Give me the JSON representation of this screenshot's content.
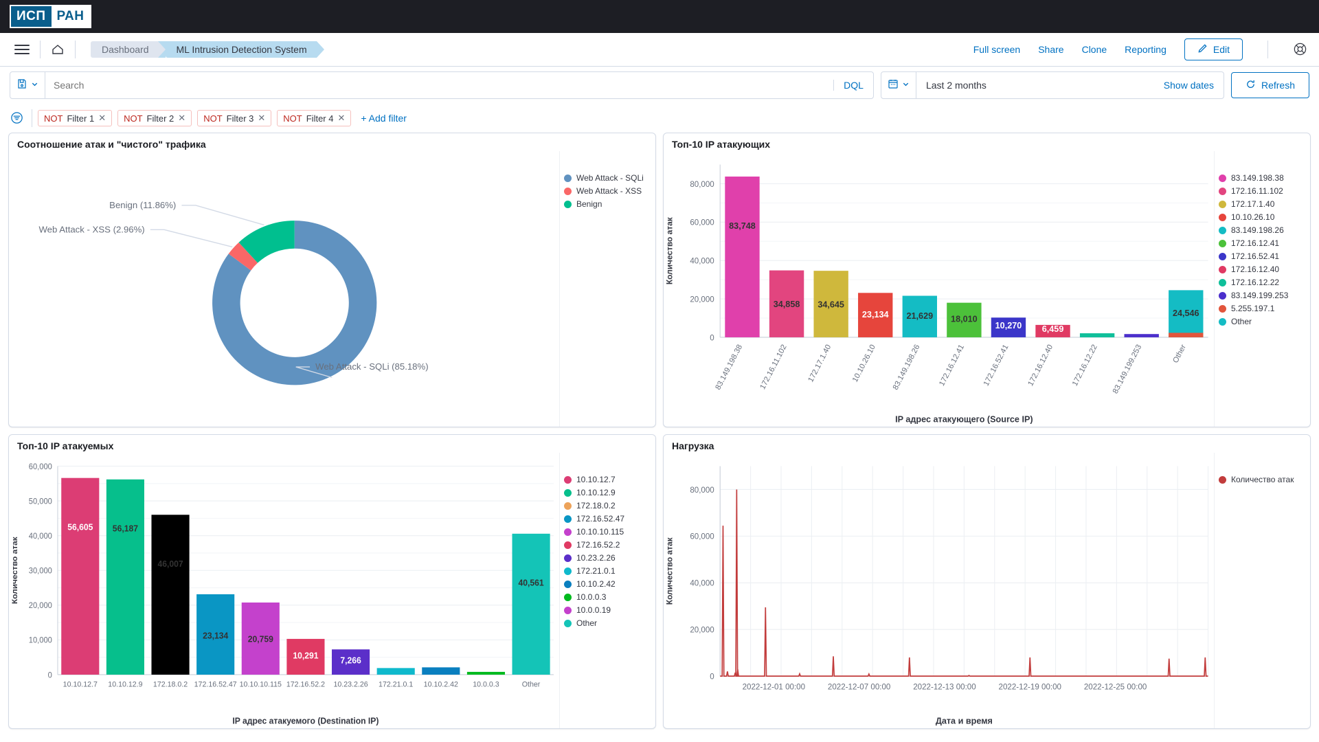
{
  "brand": {
    "logo_left": "ИСП",
    "logo_right": "РАН"
  },
  "header": {
    "menu_icon": "hamburger-icon",
    "home_icon": "home-icon",
    "breadcrumbs": [
      {
        "label": "Dashboard"
      },
      {
        "label": "ML Intrusion Detection System"
      }
    ],
    "links": [
      {
        "label": "Full screen"
      },
      {
        "label": "Share"
      },
      {
        "label": "Clone"
      },
      {
        "label": "Reporting"
      }
    ],
    "edit_label": "Edit",
    "edit_icon": "pencil-icon",
    "help_icon": "help-lifebuoy-icon"
  },
  "query": {
    "saved_query_icon": "saved-query-icon",
    "placeholder": "Search",
    "value": "",
    "language": "DQL",
    "calendar_icon": "calendar-icon",
    "date_range": "Last 2 months",
    "show_dates": "Show dates",
    "refresh_label": "Refresh",
    "refresh_icon": "refresh-icon"
  },
  "filters": {
    "global_icon": "filter-settings-icon",
    "items": [
      {
        "negate": "NOT",
        "label": "Filter 1",
        "remove": "✕"
      },
      {
        "negate": "NOT",
        "label": "Filter 2",
        "remove": "✕"
      },
      {
        "negate": "NOT",
        "label": "Filter 3",
        "remove": "✕"
      },
      {
        "negate": "NOT",
        "label": "Filter 4",
        "remove": "✕"
      }
    ],
    "add_label": "+ Add filter"
  },
  "panels": {
    "donut": {
      "title": "Соотношение атак и \"чистого\" трафика"
    },
    "source": {
      "title": "Топ-10 IP атакующих"
    },
    "dest": {
      "title": "Топ-10 IP атакуемых"
    },
    "load": {
      "title": "Нагрузка"
    }
  },
  "chart_data": [
    {
      "id": "donut",
      "type": "pie",
      "title": "Соотношение атак и \"чистого\" трафика",
      "donut": true,
      "legend_position": "right",
      "labels": [
        "Web Attack - SQLi",
        "Web Attack - XSS",
        "Benign"
      ],
      "values": [
        85.18,
        2.96,
        11.86
      ],
      "unit": "%",
      "colors": [
        "#6092c0",
        "#fa6767",
        "#00bf8f"
      ],
      "callouts": [
        {
          "text": "Benign (11.86%)"
        },
        {
          "text": "Web Attack - XSS (2.96%)"
        },
        {
          "text": "Web Attack - SQLi (85.18%)"
        }
      ],
      "legend": [
        {
          "label": "Web Attack - SQLi",
          "color": "#6092c0"
        },
        {
          "label": "Web Attack - XSS",
          "color": "#fa6767"
        },
        {
          "label": "Benign",
          "color": "#00bf8f"
        }
      ]
    },
    {
      "id": "source_ip",
      "type": "bar",
      "title": "Топ-10 IP атакующих",
      "xlabel": "IP адрес атакующего (Source IP)",
      "ylabel": "Количество атак",
      "ylim": [
        0,
        90000
      ],
      "yticks": [
        0,
        20000,
        40000,
        60000,
        80000
      ],
      "ytick_labels": [
        "0",
        "20,000",
        "40,000",
        "60,000",
        "80,000"
      ],
      "grid": true,
      "legend_position": "right",
      "categories": [
        "83.149.198.38",
        "172.16.11.102",
        "172.17.1.40",
        "10.10.26.10",
        "83.149.198.26",
        "172.16.12.41",
        "172.16.52.41",
        "172.16.12.40",
        "172.16.12.22",
        "83.149.199.253",
        "Other"
      ],
      "values": [
        83748,
        34858,
        34645,
        23134,
        21629,
        18010,
        10270,
        6459,
        2100,
        1700,
        24546
      ],
      "value_labels": [
        "83,748",
        "34,858",
        "34,645",
        "23,134",
        "21,629",
        "18,010",
        "10,270",
        "6,459",
        "",
        "",
        "24,546"
      ],
      "colors": [
        "#e040ab",
        "#e2457f",
        "#cfb83c",
        "#e6453c",
        "#14bcc4",
        "#4cc13a",
        "#3b36c9",
        "#e03a63",
        "#0fbf9a",
        "#4b2fcc",
        "#14bcc4"
      ],
      "legend": [
        {
          "label": "83.149.198.38",
          "color": "#e040ab"
        },
        {
          "label": "172.16.11.102",
          "color": "#e2457f"
        },
        {
          "label": "172.17.1.40",
          "color": "#cfb83c"
        },
        {
          "label": "10.10.26.10",
          "color": "#e6453c"
        },
        {
          "label": "83.149.198.26",
          "color": "#14bcc4"
        },
        {
          "label": "172.16.12.41",
          "color": "#4cc13a"
        },
        {
          "label": "172.16.52.41",
          "color": "#3b36c9"
        },
        {
          "label": "172.16.12.40",
          "color": "#e03a63"
        },
        {
          "label": "172.16.12.22",
          "color": "#0fbf9a"
        },
        {
          "label": "83.149.199.253",
          "color": "#4b2fcc"
        },
        {
          "label": "5.255.197.1",
          "color": "#e2553c"
        },
        {
          "label": "Other",
          "color": "#14bcc4"
        }
      ]
    },
    {
      "id": "dest_ip",
      "type": "bar",
      "title": "Топ-10 IP атакуемых",
      "xlabel": "IP адрес атакуемого (Destination IP)",
      "ylabel": "Количество атак",
      "ylim": [
        0,
        60000
      ],
      "yticks": [
        0,
        10000,
        20000,
        30000,
        40000,
        50000,
        60000
      ],
      "ytick_labels": [
        "0",
        "10,000",
        "20,000",
        "30,000",
        "40,000",
        "50,000",
        "60,000"
      ],
      "grid": true,
      "legend_position": "right",
      "categories": [
        "10.10.12.7",
        "10.10.12.9",
        "172.18.0.2",
        "172.16.52.47",
        "10.10.10.115",
        "172.16.52.2",
        "10.23.2.26",
        "172.21.0.1",
        "10.10.2.42",
        "10.0.0.3",
        "Other"
      ],
      "values": [
        56605,
        56187,
        46007,
        23134,
        20759,
        10291,
        7266,
        1900,
        2100,
        800,
        40561
      ],
      "value_labels": [
        "56,605",
        "56,187",
        "46,007",
        "23,134",
        "20,759",
        "10,291",
        "7,266",
        "",
        "",
        "",
        "40,561"
      ],
      "colors": [
        "#dc3d74",
        "#06bf8c",
        "#edа35a",
        "#0a96c4",
        "#c441cc",
        "#e03a63",
        "#5b2fc9",
        "#0fb9cc",
        "#0a7fbf",
        "#00ba1e",
        "#14c4b7"
      ],
      "legend": [
        {
          "label": "10.10.12.7",
          "color": "#dc3d74"
        },
        {
          "label": "10.10.12.9",
          "color": "#06bf8c"
        },
        {
          "label": "172.18.0.2",
          "color": "#eda35a"
        },
        {
          "label": "172.16.52.47",
          "color": "#0a96c4"
        },
        {
          "label": "10.10.10.115",
          "color": "#c441cc"
        },
        {
          "label": "172.16.52.2",
          "color": "#e03a63"
        },
        {
          "label": "10.23.2.26",
          "color": "#5b2fc9"
        },
        {
          "label": "172.21.0.1",
          "color": "#0fb9cc"
        },
        {
          "label": "10.10.2.42",
          "color": "#0a7fbf"
        },
        {
          "label": "10.0.0.3",
          "color": "#00ba1e"
        },
        {
          "label": "10.0.0.19",
          "color": "#c441cc"
        },
        {
          "label": "Other",
          "color": "#14c4b7"
        }
      ]
    },
    {
      "id": "load",
      "type": "line",
      "title": "Нагрузка",
      "xlabel": "Дата и время",
      "ylabel": "Количество атак",
      "ylim": [
        0,
        90000
      ],
      "yticks": [
        0,
        20000,
        40000,
        60000,
        80000
      ],
      "ytick_labels": [
        "0",
        "20,000",
        "40,000",
        "60,000",
        "80,000"
      ],
      "grid": true,
      "legend_position": "right",
      "series_name": "Количество атак",
      "series_color": "#c23c3c",
      "xticks": [
        "2022-12-01 00:00",
        "2022-12-07 00:00",
        "2022-12-13 00:00",
        "2022-12-19 00:00",
        "2022-12-25 00:00"
      ],
      "x": [
        0.6,
        1.5,
        3.1,
        3.4,
        3.6,
        9.3,
        16.3,
        23.2,
        30.5,
        38.8,
        51.0,
        63.5,
        92.0,
        99.4
      ],
      "values": [
        64500,
        2000,
        1500,
        80000,
        3000,
        29500,
        1000,
        8500,
        900,
        8000,
        300,
        8000,
        7500,
        8000
      ]
    }
  ]
}
